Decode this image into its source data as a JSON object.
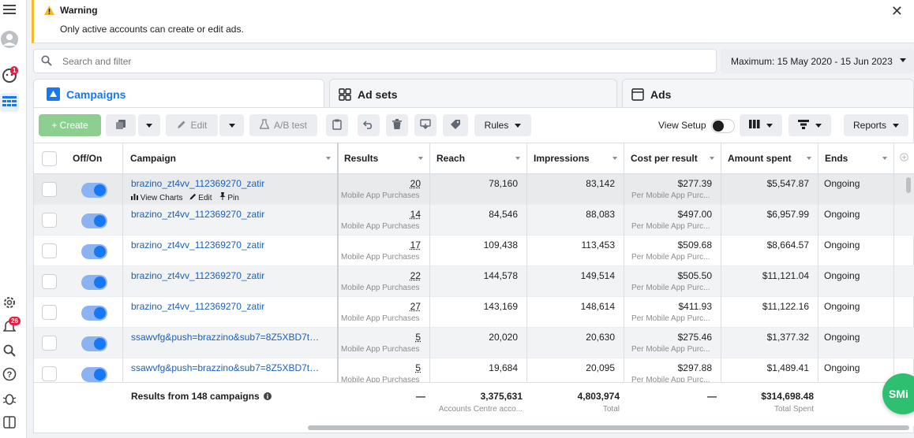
{
  "sidebar": {
    "notifications_badge": "1",
    "alerts_badge": "26"
  },
  "warning": {
    "title": "Warning",
    "message": "Only active accounts can create or edit ads."
  },
  "search": {
    "placeholder": "Search and filter"
  },
  "date_range": {
    "label": "Maximum: 15 May 2020 - 15 Jun 2023"
  },
  "tabs": [
    {
      "label": "Campaigns",
      "active": true
    },
    {
      "label": "Ad sets",
      "active": false
    },
    {
      "label": "Ads",
      "active": false
    }
  ],
  "toolbar": {
    "create_label": "+ Create",
    "edit_label": "Edit",
    "ab_test_label": "A/B test",
    "rules_label": "Rules",
    "view_setup_label": "View Setup",
    "reports_label": "Reports"
  },
  "columns": [
    "Off/On",
    "Campaign",
    "Results",
    "Reach",
    "Impressions",
    "Cost per result",
    "Amount spent",
    "Ends"
  ],
  "row_actions": {
    "view_charts": "View Charts",
    "edit": "Edit",
    "pin": "Pin"
  },
  "rows": [
    {
      "campaign": "brazino_zt4vv_112369270_zatir",
      "results": "20",
      "results_sub": "Mobile App Purchases",
      "reach": "78,160",
      "impressions": "83,142",
      "cost": "$277.39",
      "cost_sub": "Per Mobile App Purc...",
      "spent": "$5,547.87",
      "ends": "Ongoing"
    },
    {
      "campaign": "brazino_zt4vv_112369270_zatir",
      "results": "14",
      "results_sub": "Mobile App Purchases",
      "reach": "84,546",
      "impressions": "88,083",
      "cost": "$497.00",
      "cost_sub": "Per Mobile App Purc...",
      "spent": "$6,957.99",
      "ends": "Ongoing"
    },
    {
      "campaign": "brazino_zt4vv_112369270_zatir",
      "results": "17",
      "results_sub": "Mobile App Purchases",
      "reach": "109,438",
      "impressions": "113,453",
      "cost": "$509.68",
      "cost_sub": "Per Mobile App Purc...",
      "spent": "$8,664.57",
      "ends": "Ongoing"
    },
    {
      "campaign": "brazino_zt4vv_112369270_zatir",
      "results": "22",
      "results_sub": "Mobile App Purchases",
      "reach": "144,578",
      "impressions": "149,514",
      "cost": "$505.50",
      "cost_sub": "Per Mobile App Purc...",
      "spent": "$11,121.04",
      "ends": "Ongoing"
    },
    {
      "campaign": "brazino_zt4vv_112369270_zatir",
      "results": "27",
      "results_sub": "Mobile App Purchases",
      "reach": "143,169",
      "impressions": "148,614",
      "cost": "$411.93",
      "cost_sub": "Per Mobile App Purc...",
      "spent": "$11,122.16",
      "ends": "Ongoing"
    },
    {
      "campaign": "ssawvfg&push=brazzino&sub7=8Z5XBD7t&s...",
      "results": "5",
      "results_sub": "Mobile App Purchases",
      "reach": "20,020",
      "impressions": "20,630",
      "cost": "$275.46",
      "cost_sub": "Per Mobile App Purc...",
      "spent": "$1,377.32",
      "ends": "Ongoing"
    },
    {
      "campaign": "ssawvfg&push=brazzino&sub7=8Z5XBD7t&s...",
      "results": "5",
      "results_sub": "Mobile App Purchases",
      "reach": "19,684",
      "impressions": "20,095",
      "cost": "$297.88",
      "cost_sub": "Per Mobile App Purc...",
      "spent": "$1,489.41",
      "ends": "Ongoing"
    }
  ],
  "totals": {
    "label": "Results from 148 campaigns",
    "results": "—",
    "reach": "3,375,631",
    "reach_sub": "Accounts Centre acco...",
    "impressions": "4,803,974",
    "impressions_sub": "Total",
    "cost": "—",
    "spent": "$314,698.48",
    "spent_sub": "Total Spent"
  },
  "fab_label": "SMi"
}
